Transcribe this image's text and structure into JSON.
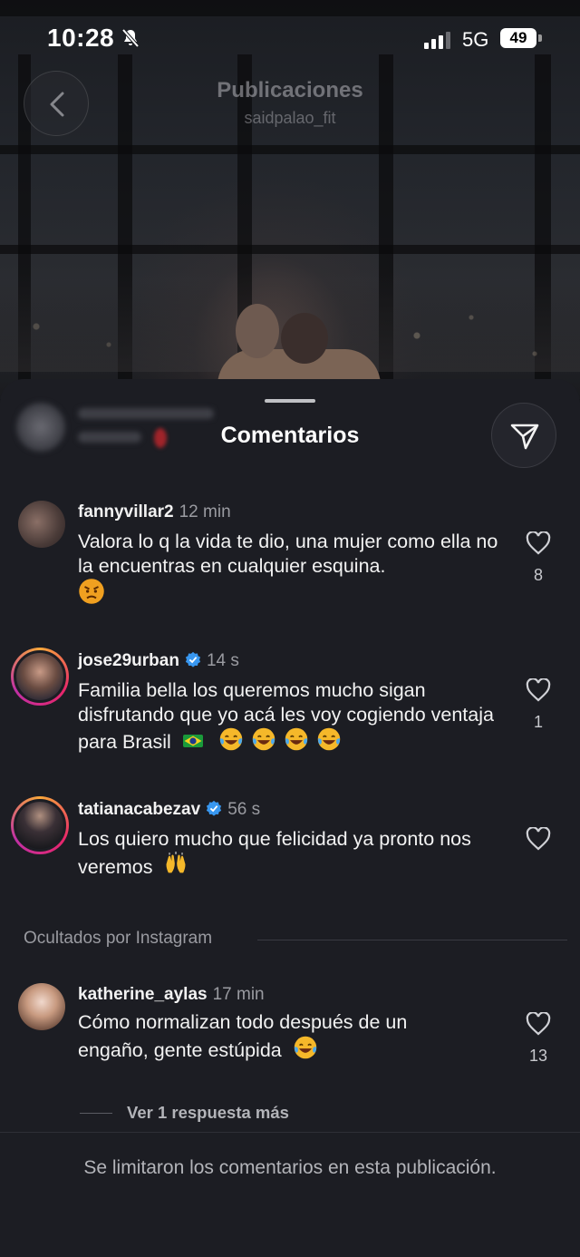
{
  "status_bar": {
    "time": "10:28",
    "network": "5G",
    "battery": "49"
  },
  "header": {
    "title": "Publicaciones",
    "subtitle": "saidpalao_fit"
  },
  "sheet": {
    "title": "Comentarios"
  },
  "comments": [
    {
      "username": "fannyvillar2",
      "time": "12 min",
      "text": "Valora lo q la vida te dio, una mujer como ella no la encuentras en cualquier esquina.",
      "emoji": "angry-face",
      "likes": "8",
      "verified": false
    },
    {
      "username": "jose29urban",
      "time": "14 s",
      "text": "Familia bella los queremos mucho sigan disfrutando que yo acá les voy cogiendo ventaja para Brasil",
      "emoji": "brazil-flag, tears-of-joy x4",
      "likes": "1",
      "verified": true
    },
    {
      "username": "tatianacabezav",
      "time": "56 s",
      "text": "Los quiero mucho que felicidad ya pronto nos veremos",
      "emoji": "raising-hands",
      "likes": "",
      "verified": true
    },
    {
      "username": "katherine_aylas",
      "time": "17 min",
      "text": "Cómo normalizan todo después de un engaño, gente estúpida",
      "emoji": "tears-of-joy",
      "likes": "13",
      "verified": false
    }
  ],
  "hidden_section": {
    "label": "Ocultados por Instagram"
  },
  "replies": {
    "label": "Ver 1 respuesta más"
  },
  "footer": {
    "text": "Se limitaron los comentarios en esta publicación."
  },
  "colors": {
    "sheet_bg": "#1c1d23",
    "verified_blue": "#3897f0",
    "story_ring": "#e8266a"
  }
}
